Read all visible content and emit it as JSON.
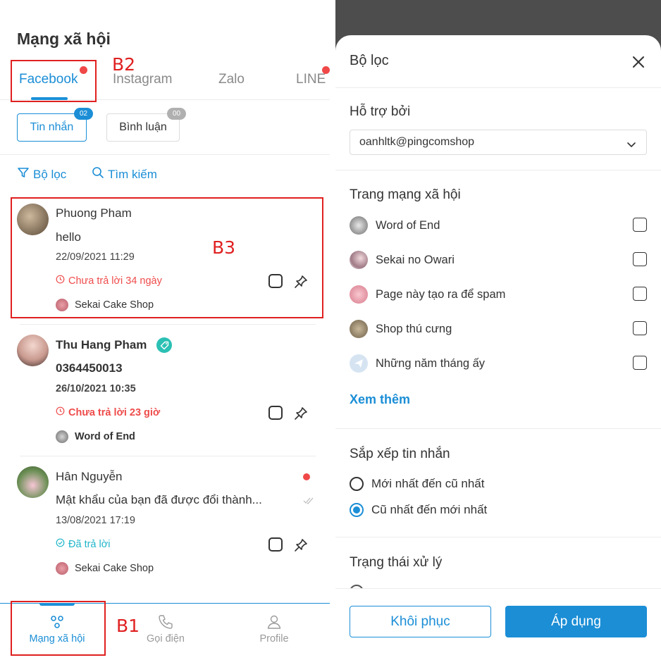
{
  "left": {
    "title": "Mạng xã hội",
    "tabs": [
      {
        "label": "Facebook",
        "active": true
      },
      {
        "label": "Instagram",
        "active": false
      },
      {
        "label": "Zalo",
        "active": false
      },
      {
        "label": "LINE",
        "active": false
      }
    ],
    "chips": [
      {
        "label": "Tin nhắn",
        "badge": "02",
        "active": true
      },
      {
        "label": "Bình luận",
        "badge": "00",
        "active": false
      }
    ],
    "actions": {
      "filter": "Bộ lọc",
      "search": "Tìm kiếm"
    },
    "conversations": [
      {
        "name": "Phuong Pham",
        "message": "hello",
        "time": "22/09/2021 11:29",
        "status": "Chưa trả lời 34 ngày",
        "status_color": "#ef4b4b",
        "page": "Sekai Cake Shop",
        "bold": false
      },
      {
        "name": "Thu Hang Pham",
        "message": "0364450013",
        "time": "26/10/2021 10:35",
        "status": "Chưa trả lời 23 giờ",
        "status_color": "#ef4b4b",
        "page": "Word of End",
        "bold": true
      },
      {
        "name": "Hân Nguyễn",
        "message": "Mật khẩu của bạn đã được đổi thành...",
        "time": "13/08/2021 17:19",
        "status": "Đã trả lời",
        "status_color": "#1fb5c9",
        "page": "Sekai Cake Shop",
        "bold": false
      }
    ],
    "bottom_nav": [
      {
        "label": "Mạng xã hội",
        "active": true
      },
      {
        "label": "Gọi điện",
        "active": false
      },
      {
        "label": "Profile",
        "active": false
      }
    ],
    "annotations": {
      "b1": "B1",
      "b2": "B2",
      "b3": "B3"
    }
  },
  "right": {
    "title": "Bộ lọc",
    "supported_by": {
      "title": "Hỗ trợ bởi",
      "value": "oanhltk@pingcomshop"
    },
    "social_pages": {
      "title": "Trang mạng xã hội",
      "items": [
        {
          "label": "Word of End",
          "checked": false
        },
        {
          "label": "Sekai no Owari",
          "checked": false
        },
        {
          "label": "Page này tạo ra để spam",
          "checked": false
        },
        {
          "label": "Shop thú cưng",
          "checked": false
        },
        {
          "label": "Những năm tháng ấy",
          "checked": false
        }
      ],
      "see_more": "Xem thêm"
    },
    "sort": {
      "title": "Sắp xếp tin nhắn",
      "options": [
        {
          "label": "Mới nhất đến cũ nhất",
          "selected": false
        },
        {
          "label": "Cũ nhất đến mới nhất",
          "selected": true
        }
      ]
    },
    "processing_status": {
      "title": "Trạng thái xử lý"
    },
    "buttons": {
      "reset": "Khôi phục",
      "apply": "Áp dụng"
    }
  },
  "colors": {
    "accent": "#1b8ed6",
    "danger": "#ef4b4b",
    "replied": "#1fb5c9",
    "annotation": "#e02020"
  }
}
